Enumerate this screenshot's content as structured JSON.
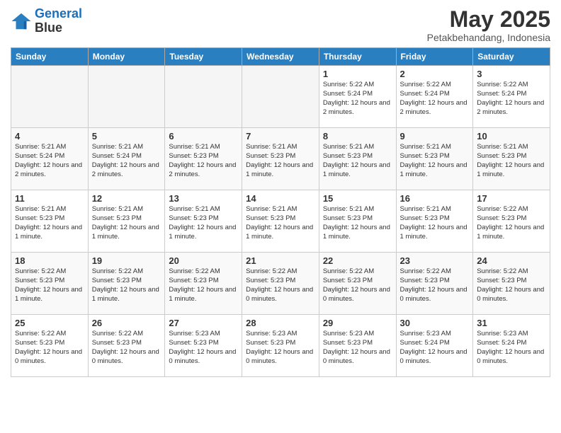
{
  "logo": {
    "line1": "General",
    "line2": "Blue"
  },
  "title": "May 2025",
  "subtitle": "Petakbehandang, Indonesia",
  "weekdays": [
    "Sunday",
    "Monday",
    "Tuesday",
    "Wednesday",
    "Thursday",
    "Friday",
    "Saturday"
  ],
  "weeks": [
    [
      {
        "day": "",
        "empty": true
      },
      {
        "day": "",
        "empty": true
      },
      {
        "day": "",
        "empty": true
      },
      {
        "day": "",
        "empty": true
      },
      {
        "day": "1",
        "sunrise": "5:22 AM",
        "sunset": "5:24 PM",
        "daylight": "12 hours and 2 minutes."
      },
      {
        "day": "2",
        "sunrise": "5:22 AM",
        "sunset": "5:24 PM",
        "daylight": "12 hours and 2 minutes."
      },
      {
        "day": "3",
        "sunrise": "5:22 AM",
        "sunset": "5:24 PM",
        "daylight": "12 hours and 2 minutes."
      }
    ],
    [
      {
        "day": "4",
        "sunrise": "5:21 AM",
        "sunset": "5:24 PM",
        "daylight": "12 hours and 2 minutes."
      },
      {
        "day": "5",
        "sunrise": "5:21 AM",
        "sunset": "5:24 PM",
        "daylight": "12 hours and 2 minutes."
      },
      {
        "day": "6",
        "sunrise": "5:21 AM",
        "sunset": "5:23 PM",
        "daylight": "12 hours and 2 minutes."
      },
      {
        "day": "7",
        "sunrise": "5:21 AM",
        "sunset": "5:23 PM",
        "daylight": "12 hours and 1 minute."
      },
      {
        "day": "8",
        "sunrise": "5:21 AM",
        "sunset": "5:23 PM",
        "daylight": "12 hours and 1 minute."
      },
      {
        "day": "9",
        "sunrise": "5:21 AM",
        "sunset": "5:23 PM",
        "daylight": "12 hours and 1 minute."
      },
      {
        "day": "10",
        "sunrise": "5:21 AM",
        "sunset": "5:23 PM",
        "daylight": "12 hours and 1 minute."
      }
    ],
    [
      {
        "day": "11",
        "sunrise": "5:21 AM",
        "sunset": "5:23 PM",
        "daylight": "12 hours and 1 minute."
      },
      {
        "day": "12",
        "sunrise": "5:21 AM",
        "sunset": "5:23 PM",
        "daylight": "12 hours and 1 minute."
      },
      {
        "day": "13",
        "sunrise": "5:21 AM",
        "sunset": "5:23 PM",
        "daylight": "12 hours and 1 minute."
      },
      {
        "day": "14",
        "sunrise": "5:21 AM",
        "sunset": "5:23 PM",
        "daylight": "12 hours and 1 minute."
      },
      {
        "day": "15",
        "sunrise": "5:21 AM",
        "sunset": "5:23 PM",
        "daylight": "12 hours and 1 minute."
      },
      {
        "day": "16",
        "sunrise": "5:21 AM",
        "sunset": "5:23 PM",
        "daylight": "12 hours and 1 minute."
      },
      {
        "day": "17",
        "sunrise": "5:22 AM",
        "sunset": "5:23 PM",
        "daylight": "12 hours and 1 minute."
      }
    ],
    [
      {
        "day": "18",
        "sunrise": "5:22 AM",
        "sunset": "5:23 PM",
        "daylight": "12 hours and 1 minute."
      },
      {
        "day": "19",
        "sunrise": "5:22 AM",
        "sunset": "5:23 PM",
        "daylight": "12 hours and 1 minute."
      },
      {
        "day": "20",
        "sunrise": "5:22 AM",
        "sunset": "5:23 PM",
        "daylight": "12 hours and 1 minute."
      },
      {
        "day": "21",
        "sunrise": "5:22 AM",
        "sunset": "5:23 PM",
        "daylight": "12 hours and 0 minutes."
      },
      {
        "day": "22",
        "sunrise": "5:22 AM",
        "sunset": "5:23 PM",
        "daylight": "12 hours and 0 minutes."
      },
      {
        "day": "23",
        "sunrise": "5:22 AM",
        "sunset": "5:23 PM",
        "daylight": "12 hours and 0 minutes."
      },
      {
        "day": "24",
        "sunrise": "5:22 AM",
        "sunset": "5:23 PM",
        "daylight": "12 hours and 0 minutes."
      }
    ],
    [
      {
        "day": "25",
        "sunrise": "5:22 AM",
        "sunset": "5:23 PM",
        "daylight": "12 hours and 0 minutes."
      },
      {
        "day": "26",
        "sunrise": "5:22 AM",
        "sunset": "5:23 PM",
        "daylight": "12 hours and 0 minutes."
      },
      {
        "day": "27",
        "sunrise": "5:23 AM",
        "sunset": "5:23 PM",
        "daylight": "12 hours and 0 minutes."
      },
      {
        "day": "28",
        "sunrise": "5:23 AM",
        "sunset": "5:23 PM",
        "daylight": "12 hours and 0 minutes."
      },
      {
        "day": "29",
        "sunrise": "5:23 AM",
        "sunset": "5:23 PM",
        "daylight": "12 hours and 0 minutes."
      },
      {
        "day": "30",
        "sunrise": "5:23 AM",
        "sunset": "5:24 PM",
        "daylight": "12 hours and 0 minutes."
      },
      {
        "day": "31",
        "sunrise": "5:23 AM",
        "sunset": "5:24 PM",
        "daylight": "12 hours and 0 minutes."
      }
    ]
  ]
}
